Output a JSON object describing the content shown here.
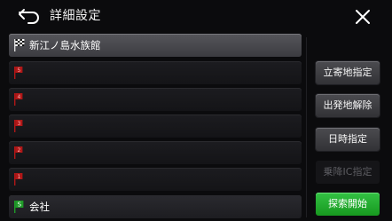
{
  "header": {
    "title": "詳細設定",
    "back_icon": "back-arrow-icon",
    "close_icon": "close-icon"
  },
  "route": {
    "items": [
      {
        "kind": "destination",
        "icon": "checkered-flag-icon",
        "label": "新江ノ島水族館",
        "flag_number": ""
      },
      {
        "kind": "waypoint",
        "icon": "red-flag-icon",
        "label": "",
        "flag_number": "5"
      },
      {
        "kind": "waypoint",
        "icon": "red-flag-icon",
        "label": "",
        "flag_number": "4"
      },
      {
        "kind": "waypoint",
        "icon": "red-flag-icon",
        "label": "",
        "flag_number": "3"
      },
      {
        "kind": "waypoint",
        "icon": "red-flag-icon",
        "label": "",
        "flag_number": "2"
      },
      {
        "kind": "waypoint",
        "icon": "red-flag-icon",
        "label": "",
        "flag_number": "1"
      },
      {
        "kind": "start",
        "icon": "start-flag-icon",
        "label": "会社",
        "flag_number": "S"
      }
    ]
  },
  "actions": {
    "add_waypoint": "立寄地指定",
    "release_origin": "出発地解除",
    "set_datetime": "日時指定",
    "set_entry_ic": "乗降IC指定",
    "start_search": "探索開始"
  },
  "colors": {
    "primary_green": "#22ad2e",
    "waypoint_red": "#b01717",
    "start_green": "#1f9a28"
  }
}
